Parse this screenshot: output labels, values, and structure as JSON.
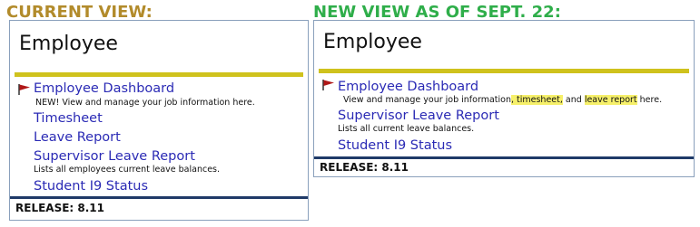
{
  "colors": {
    "current_heading": "#b28b2b",
    "new_heading": "#2fae4a",
    "link": "#2b2bb5",
    "yellow_rule": "#cfc21d",
    "navy_rule": "#1f3a68",
    "highlight": "#f6f06a",
    "flag": "#b01818"
  },
  "current_view": {
    "heading": "CURRENT VIEW:",
    "panel_title": "Employee",
    "items": [
      {
        "label": "Employee Dashboard",
        "icon": "flag-icon",
        "desc_prefix": "NEW! View and manage your job information here."
      },
      {
        "label": "Timesheet"
      },
      {
        "label": "Leave Report"
      },
      {
        "label": "Supervisor Leave Report",
        "desc": "Lists all employees current leave balances."
      },
      {
        "label": "Student I9 Status"
      }
    ],
    "release": "RELEASE: 8.11"
  },
  "new_view": {
    "heading": "NEW VIEW AS OF SEPT. 22:",
    "panel_title": "Employee",
    "items": [
      {
        "label": "Employee Dashboard",
        "icon": "flag-icon",
        "desc_parts": {
          "a": "View and manage your job information",
          "b": ", timesheet,",
          "c": " and ",
          "d": "leave report",
          "e": " here."
        }
      },
      {
        "label": "Supervisor Leave Report",
        "desc": "Lists all current leave balances."
      },
      {
        "label": "Student I9 Status"
      }
    ],
    "release": "RELEASE: 8.11"
  }
}
